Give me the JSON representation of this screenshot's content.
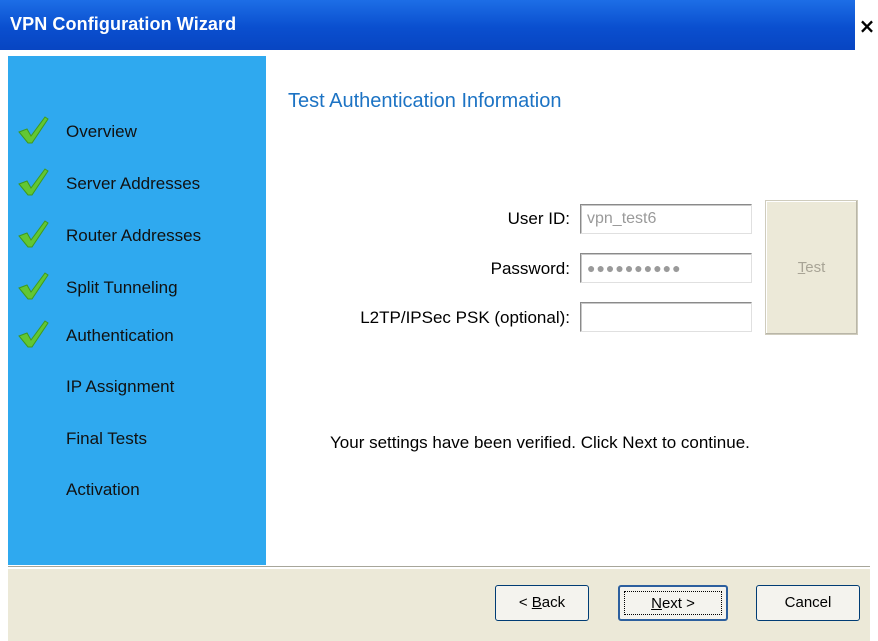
{
  "window": {
    "title": "VPN Configuration Wizard",
    "close_glyph": "×"
  },
  "sidebar": {
    "background": "#2fa9ef",
    "steps": [
      {
        "label": "Overview",
        "completed": true
      },
      {
        "label": "Server Addresses",
        "completed": true
      },
      {
        "label": "Router Addresses",
        "completed": true
      },
      {
        "label": "Split Tunneling",
        "completed": true
      },
      {
        "label": "Authentication",
        "completed": true
      },
      {
        "label": "IP Assignment",
        "completed": false
      },
      {
        "label": "Final Tests",
        "completed": false
      },
      {
        "label": "Activation",
        "completed": false
      }
    ]
  },
  "content": {
    "title": "Test Authentication Information",
    "user_id_label": "User ID:",
    "user_id_value": "vpn_test6",
    "password_label": "Password:",
    "password_value": "●●●●●●●●●●",
    "psk_label": "L2TP/IPSec PSK (optional):",
    "psk_value": "",
    "test_button_accel": "T",
    "test_button_rest": "est",
    "status_message": "Your settings have been verified. Click Next to continue."
  },
  "footer": {
    "back_prefix": "< ",
    "back_accel": "B",
    "back_rest": "ack",
    "next_accel": "N",
    "next_rest": "ext >",
    "cancel_label": "Cancel"
  },
  "colors": {
    "title_bar": "#0a4fcf",
    "heading": "#1c73c4",
    "checkmark": "#5fc22f",
    "footer": "#ece9d8"
  }
}
